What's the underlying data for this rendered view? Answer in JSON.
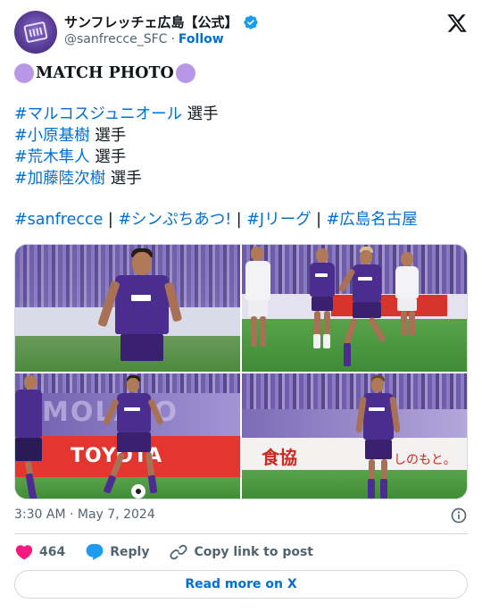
{
  "header": {
    "display_name": "サンフレッチェ広島【公式】",
    "handle": "@sanfrecce_SFC",
    "separator": "·",
    "follow_label": "Follow"
  },
  "tweet": {
    "title": "MATCH PHOTO",
    "player_lines": [
      {
        "tag": "#マルコスジュニオール",
        "suffix": " 選手"
      },
      {
        "tag": "#小原基樹",
        "suffix": " 選手"
      },
      {
        "tag": "#荒木隼人",
        "suffix": " 選手"
      },
      {
        "tag": "#加藤陸次樹",
        "suffix": " 選手"
      }
    ],
    "hashtags": [
      "#sanfrecce",
      "#シンぷちあつ!",
      "#Jリーグ",
      "#広島名古屋"
    ],
    "hashtag_separator": " | "
  },
  "photos": {
    "banner_text_p3": "TOYOTA",
    "banner_text_p4": "食協",
    "banner_text_p4_right": "しのもと。",
    "crowd_text_p3": "MOLAYO"
  },
  "footer": {
    "timestamp": "3:30 AM · May 7, 2024",
    "like_count": "464",
    "reply_label": "Reply",
    "copy_label": "Copy link to post",
    "read_more_label": "Read more on X"
  },
  "colors": {
    "link": "#006fd6",
    "like": "#f91880",
    "reply": "#1d9bf0",
    "verified": "#1d9bf0",
    "sanfrecce_purple": "#4a2d8f"
  }
}
